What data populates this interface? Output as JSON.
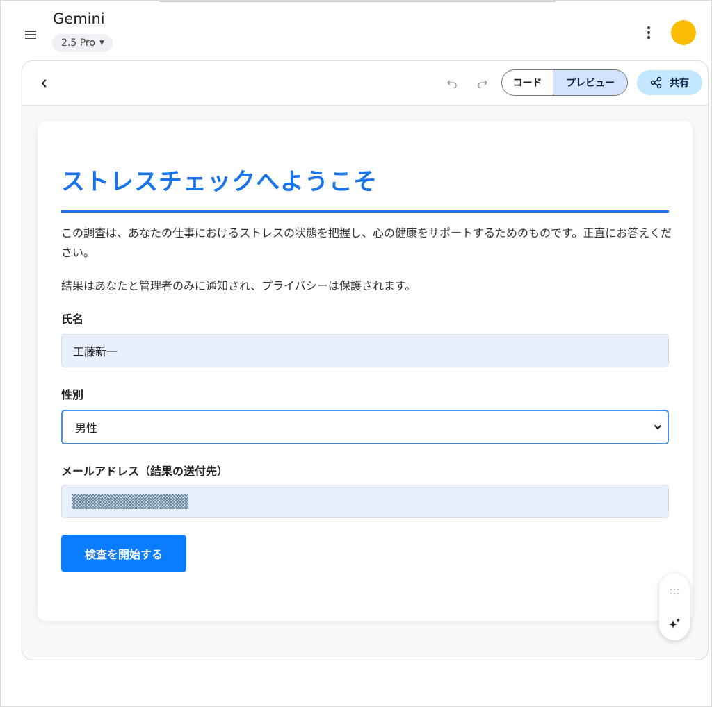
{
  "app": {
    "title": "Gemini",
    "model": "2.5 Pro"
  },
  "icons": {
    "menu": "menu-icon",
    "more": "more-vert-icon",
    "back": "chevron-left-icon",
    "undo": "undo-icon",
    "redo": "redo-icon",
    "share": "share-icon",
    "drag": "drag-grid-icon",
    "sparkle": "sparkle-icon"
  },
  "colors": {
    "accent": "#1a73e8",
    "button": "#0a7cff",
    "avatar": "#fbbc04",
    "share_bg": "#c2e7ff",
    "preview_bg": "#d3e3fd"
  },
  "toolbar": {
    "code_label": "コード",
    "preview_label": "プレビュー",
    "share_label": "共有"
  },
  "form": {
    "heading": "ストレスチェックへようこそ",
    "intro": "この調査は、あなたの仕事におけるストレスの状態を把握し、心の健康をサポートするためのものです。正直にお答えください。",
    "privacy": "結果はあなたと管理者のみに通知され、プライバシーは保護されます。",
    "name_label": "氏名",
    "name_value": "工藤新一",
    "gender_label": "性別",
    "gender_value": "男性",
    "email_label": "メールアドレス（結果の送付先）",
    "submit_label": "検査を開始する"
  }
}
